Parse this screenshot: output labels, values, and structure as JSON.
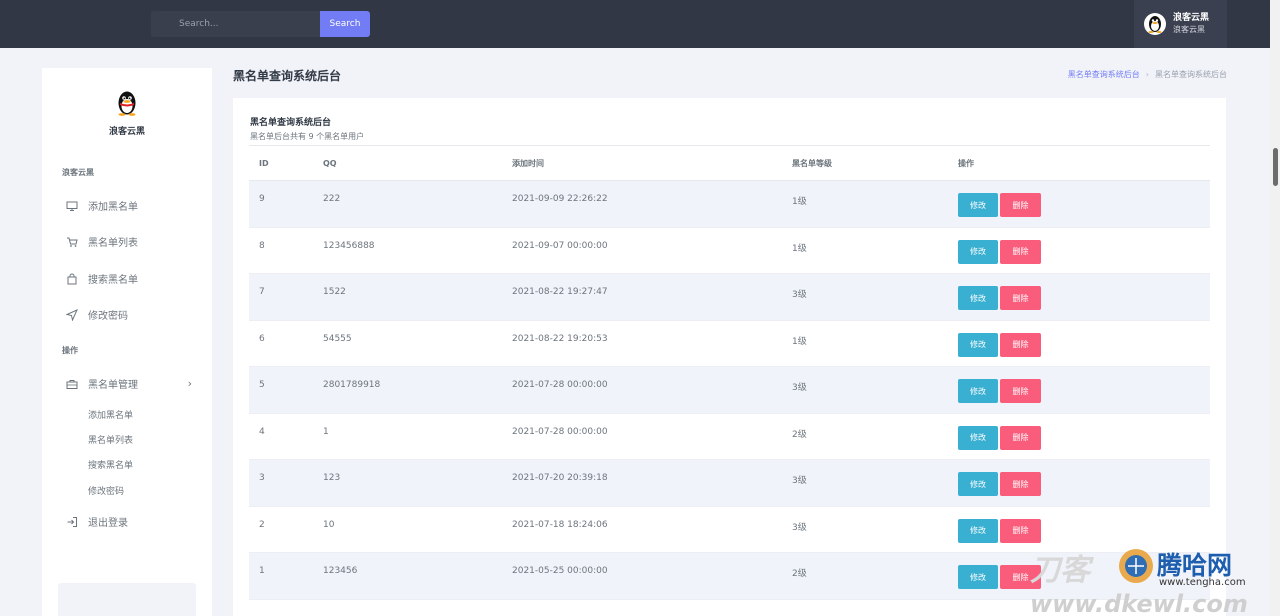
{
  "header": {
    "search_placeholder": "Search...",
    "search_button": "Search",
    "profile_name": "浪客云黑",
    "profile_sub": "浪客云黑"
  },
  "sidebar": {
    "site_name": "浪客云黑",
    "section1_title": "浪客云黑",
    "items": [
      {
        "label": "添加黑名单",
        "icon": "monitor-icon"
      },
      {
        "label": "黑名单列表",
        "icon": "cart-icon"
      },
      {
        "label": "搜索黑名单",
        "icon": "bag-icon"
      },
      {
        "label": "修改密码",
        "icon": "navigation-icon"
      }
    ],
    "section2_title": "操作",
    "manage_label": "黑名单管理",
    "sub_items": [
      "添加黑名单",
      "黑名单列表",
      "搜索黑名单",
      "修改密码"
    ],
    "logout_label": "退出登录"
  },
  "page": {
    "title": "黑名单查询系统后台",
    "breadcrumb": [
      "黑名单查询系统后台",
      "黑名单查询系统后台"
    ]
  },
  "card": {
    "title": "黑名单查询系统后台",
    "subtitle": "黑名单后台共有 9 个黑名单用户"
  },
  "table": {
    "headers": [
      "ID",
      "QQ",
      "添加时间",
      "黑名单等级",
      "操作"
    ],
    "edit_label": "修改",
    "delete_label": "删除",
    "rows": [
      {
        "id": "9",
        "qq": "222",
        "time": "2021-09-09 22:26:22",
        "level": "1级"
      },
      {
        "id": "8",
        "qq": "123456888",
        "time": "2021-09-07 00:00:00",
        "level": "1级"
      },
      {
        "id": "7",
        "qq": "1522",
        "time": "2021-08-22 19:27:47",
        "level": "3级"
      },
      {
        "id": "6",
        "qq": "54555",
        "time": "2021-08-22 19:20:53",
        "level": "1级"
      },
      {
        "id": "5",
        "qq": "2801789918",
        "time": "2021-07-28 00:00:00",
        "level": "3级"
      },
      {
        "id": "4",
        "qq": "1",
        "time": "2021-07-28 00:00:00",
        "level": "2级"
      },
      {
        "id": "3",
        "qq": "123",
        "time": "2021-07-20 20:39:18",
        "level": "3级"
      },
      {
        "id": "2",
        "qq": "10",
        "time": "2021-07-18 18:24:06",
        "level": "3级"
      },
      {
        "id": "1",
        "qq": "123456",
        "time": "2021-05-25 00:00:00",
        "level": "2级"
      }
    ]
  },
  "watermark": {
    "brand": "腾哈网",
    "url": "www.tengha.com",
    "domain": "www.dkewl.com",
    "left_text": "刀客"
  },
  "colors": {
    "topbar": "#323745",
    "accent": "#727cf5",
    "edit": "#39afd1",
    "delete": "#fa5c7c"
  }
}
